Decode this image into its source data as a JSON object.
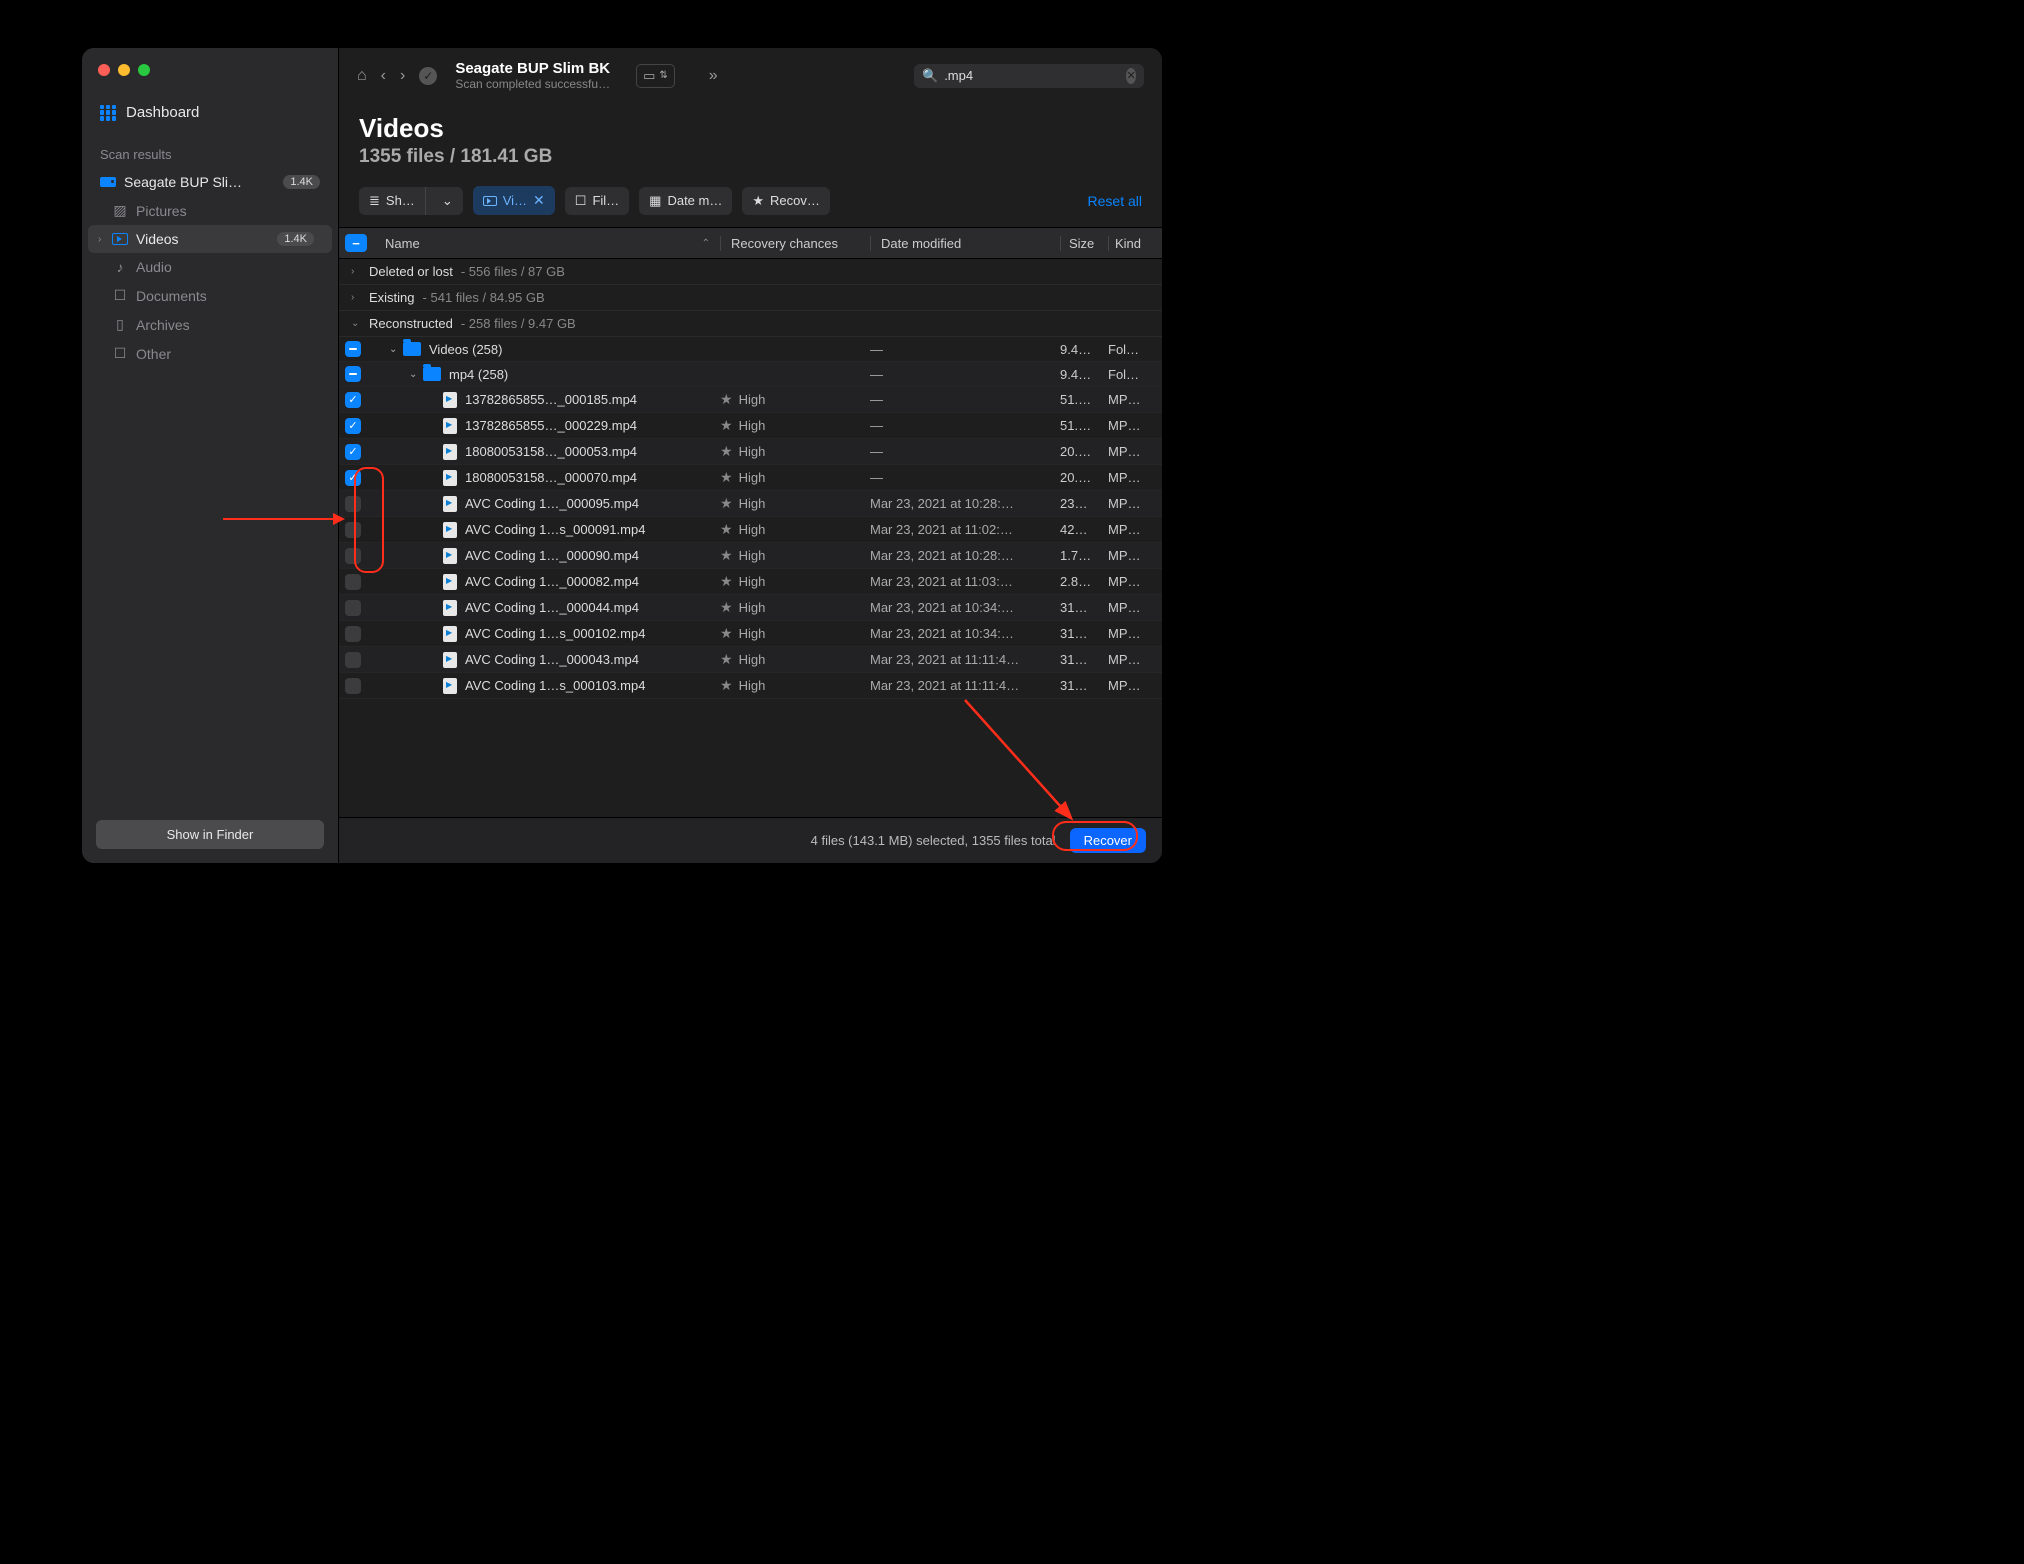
{
  "sidebar": {
    "dashboard": "Dashboard",
    "section": "Scan results",
    "drive": {
      "label": "Seagate BUP Sli…",
      "badge": "1.4K"
    },
    "items": [
      {
        "label": "Pictures"
      },
      {
        "label": "Videos",
        "badge": "1.4K",
        "active": true
      },
      {
        "label": "Audio"
      },
      {
        "label": "Documents"
      },
      {
        "label": "Archives"
      },
      {
        "label": "Other"
      }
    ],
    "show_finder": "Show in Finder"
  },
  "toolbar": {
    "title": "Seagate BUP Slim BK",
    "subtitle": "Scan completed successfu…",
    "search_value": ".mp4"
  },
  "hero": {
    "title": "Videos",
    "subtitle": "1355 files / 181.41 GB"
  },
  "filters": {
    "show": "Sh…",
    "video": "Vi…",
    "file": "Fil…",
    "date": "Date m…",
    "recov": "Recov…",
    "reset": "Reset all"
  },
  "columns": {
    "name": "Name",
    "rec": "Recovery chances",
    "date": "Date modified",
    "size": "Size",
    "kind": "Kind"
  },
  "groups": {
    "deleted": {
      "name": "Deleted or lost",
      "meta": "556 files / 87 GB"
    },
    "existing": {
      "name": "Existing",
      "meta": "541 files / 84.95 GB"
    },
    "recon": {
      "name": "Reconstructed",
      "meta": "258 files / 9.47 GB"
    }
  },
  "folders": {
    "videos": {
      "name": "Videos (258)",
      "size": "9.4…",
      "kind": "Fol…"
    },
    "mp4": {
      "name": "mp4 (258)",
      "size": "9.4…",
      "kind": "Fol…"
    }
  },
  "rows": [
    {
      "checked": true,
      "name": "13782865855…_000185.mp4",
      "rec": "High",
      "date": "—",
      "size": "51.…",
      "kind": "MP…"
    },
    {
      "checked": true,
      "name": "13782865855…_000229.mp4",
      "rec": "High",
      "date": "—",
      "size": "51.…",
      "kind": "MP…"
    },
    {
      "checked": true,
      "name": "18080053158…_000053.mp4",
      "rec": "High",
      "date": "—",
      "size": "20.…",
      "kind": "MP…"
    },
    {
      "checked": true,
      "name": "18080053158…_000070.mp4",
      "rec": "High",
      "date": "—",
      "size": "20.…",
      "kind": "MP…"
    },
    {
      "checked": false,
      "name": "AVC Coding 1…_000095.mp4",
      "rec": "High",
      "date": "Mar 23, 2021 at 10:28:…",
      "size": "23…",
      "kind": "MP…"
    },
    {
      "checked": false,
      "name": "AVC Coding 1…s_000091.mp4",
      "rec": "High",
      "date": "Mar 23, 2021 at 11:02:…",
      "size": "42…",
      "kind": "MP…"
    },
    {
      "checked": false,
      "name": "AVC Coding 1…_000090.mp4",
      "rec": "High",
      "date": "Mar 23, 2021 at 10:28:…",
      "size": "1.7…",
      "kind": "MP…"
    },
    {
      "checked": false,
      "name": "AVC Coding 1…_000082.mp4",
      "rec": "High",
      "date": "Mar 23, 2021 at 11:03:…",
      "size": "2.8…",
      "kind": "MP…"
    },
    {
      "checked": false,
      "name": "AVC Coding 1…_000044.mp4",
      "rec": "High",
      "date": "Mar 23, 2021 at 10:34:…",
      "size": "31…",
      "kind": "MP…"
    },
    {
      "checked": false,
      "name": "AVC Coding 1…s_000102.mp4",
      "rec": "High",
      "date": "Mar 23, 2021 at 10:34:…",
      "size": "31…",
      "kind": "MP…"
    },
    {
      "checked": false,
      "name": "AVC Coding 1…_000043.mp4",
      "rec": "High",
      "date": "Mar 23, 2021 at 11:11:4…",
      "size": "31…",
      "kind": "MP…"
    },
    {
      "checked": false,
      "name": "AVC Coding 1…s_000103.mp4",
      "rec": "High",
      "date": "Mar 23, 2021 at 11:11:4…",
      "size": "31…",
      "kind": "MP…"
    }
  ],
  "footer": {
    "status": "4 files (143.1 MB) selected, 1355 files total",
    "recover": "Recover"
  }
}
